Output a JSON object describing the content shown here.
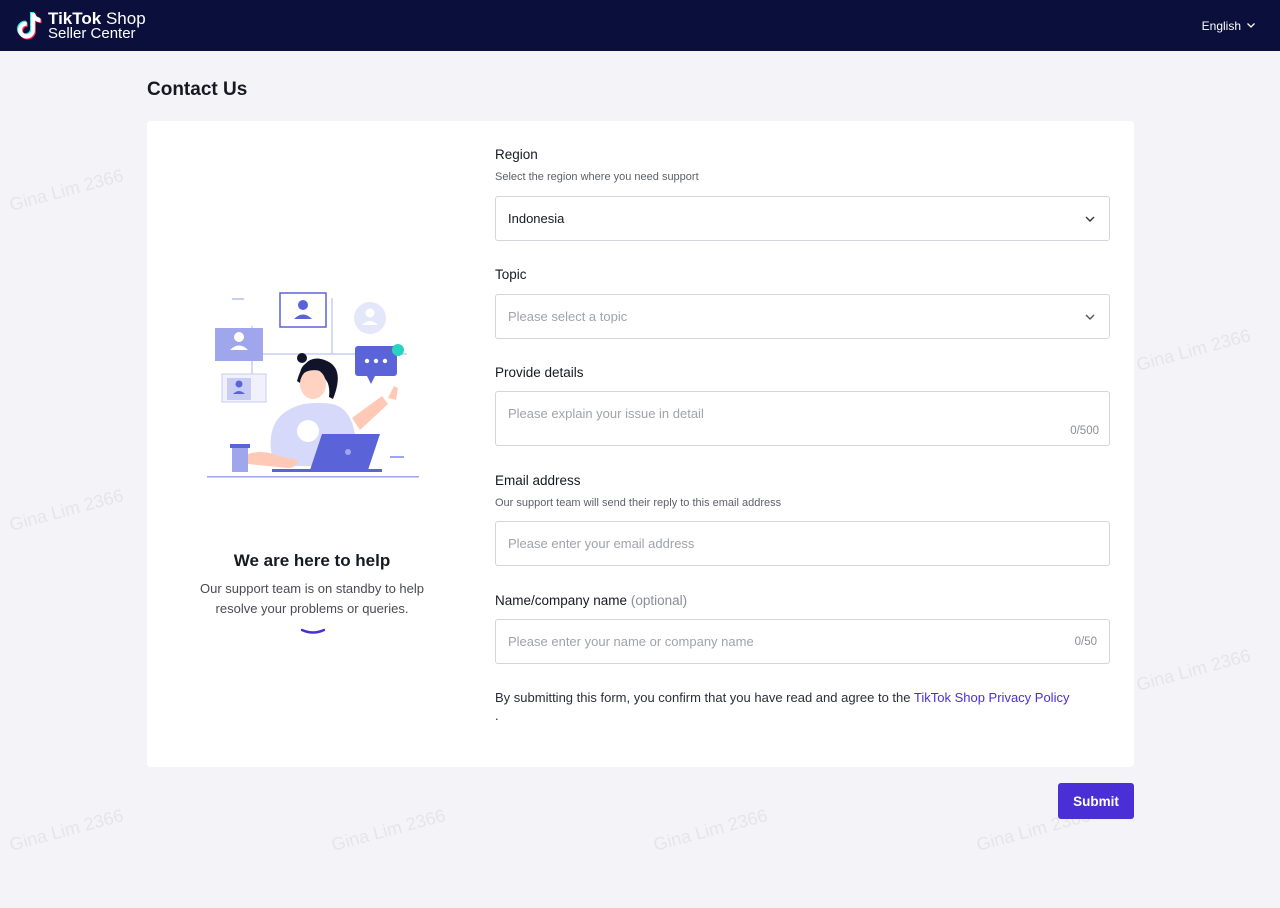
{
  "header": {
    "brand_line1_bold": "TikTok",
    "brand_line1_rest": " Shop",
    "brand_line2": "Seller Center",
    "language": "English"
  },
  "page": {
    "title": "Contact Us"
  },
  "left_panel": {
    "title": "We are here to help",
    "subtitle": "Our support team is on standby to help resolve your problems or queries."
  },
  "form": {
    "region": {
      "label": "Region",
      "hint": "Select the region where you need support",
      "value": "Indonesia"
    },
    "topic": {
      "label": "Topic",
      "placeholder": "Please select a topic"
    },
    "details": {
      "label": "Provide details",
      "placeholder": "Please explain your issue in detail",
      "counter": "0/500"
    },
    "email": {
      "label": "Email address",
      "hint": "Our support team will send their reply to this email address",
      "placeholder": "Please enter your email address"
    },
    "name": {
      "label": "Name/company name",
      "optional": "(optional)",
      "placeholder": "Please enter your name or company name",
      "counter": "0/50"
    },
    "consent_text": "By submitting this form, you confirm that you have read and agree to the ",
    "consent_link": "TikTok Shop Privacy Policy",
    "consent_end": "."
  },
  "actions": {
    "submit_label": "Submit"
  },
  "watermark": "Gina Lim 2366",
  "colors": {
    "header_bg": "#0b0f3b",
    "accent": "#4a2ed6",
    "page_bg": "#f4f4f8"
  },
  "icons": {
    "logo": "tiktok-logo-icon",
    "language_chevron": "chevron-down-icon",
    "select_chevron": "chevron-down-icon"
  }
}
